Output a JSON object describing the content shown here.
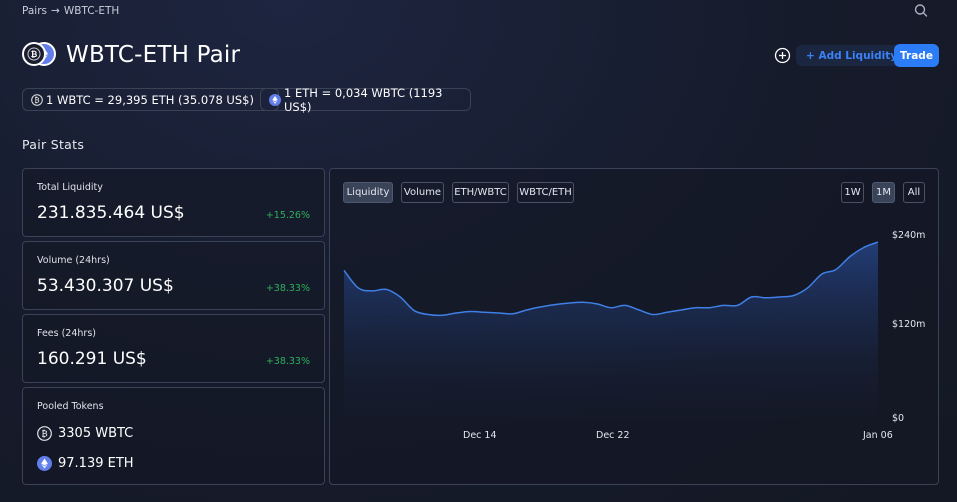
{
  "breadcrumb": {
    "root": "Pairs",
    "separator": "→",
    "current": "WBTC-ETH"
  },
  "header": {
    "title": "WBTC-ETH Pair",
    "add_liquidity_label": "+ Add Liquidity",
    "trade_label": "Trade"
  },
  "rates": [
    {
      "text": "1 WBTC = 29,395 ETH (35.078 US$)",
      "coin": "wbtc"
    },
    {
      "text": "1 ETH = 0,034 WBTC (1193 US$)",
      "coin": "eth"
    }
  ],
  "section_title": "Pair Stats",
  "stats": {
    "total_liquidity": {
      "label": "Total Liquidity",
      "value": "231.835.464 US$",
      "change": "+15.26%"
    },
    "volume": {
      "label": "Volume (24hrs)",
      "value": "53.430.307 US$",
      "change": "+38.33%"
    },
    "fees": {
      "label": "Fees (24hrs)",
      "value": "160.291 US$",
      "change": "+38.33%"
    },
    "pooled": {
      "label": "Pooled Tokens",
      "wbtc": "3305 WBTC",
      "eth": "97.139 ETH"
    }
  },
  "chart_tabs": {
    "liquidity": "Liquidity",
    "volume": "Volume",
    "eth_wbtc": "ETH/WBTC",
    "wbtc_eth": "WBTC/ETH"
  },
  "ranges": {
    "w1": "1W",
    "m1": "1M",
    "all": "All"
  },
  "colors": {
    "accent": "#2b7cf6",
    "positive": "#2eae5c",
    "line": "#3f7fe6"
  },
  "chart_data": {
    "type": "area",
    "series": [
      {
        "values": [
          195,
          172,
          168,
          170,
          160,
          142,
          137,
          136,
          139,
          141,
          140,
          139,
          138,
          143,
          147,
          150,
          152,
          153,
          151,
          146,
          149,
          143,
          137,
          140,
          143,
          146,
          146,
          149,
          149,
          160,
          159,
          160,
          162,
          172,
          190,
          196,
          213,
          225,
          232
        ]
      }
    ],
    "x_ticks": [
      "Dec 14",
      "Dec 22",
      "Jan 06"
    ],
    "y_ticks": [
      "$240m",
      "$120m",
      "$0"
    ],
    "ylim": [
      0,
      240
    ],
    "selected_metric": "Liquidity",
    "selected_range": "1M"
  }
}
